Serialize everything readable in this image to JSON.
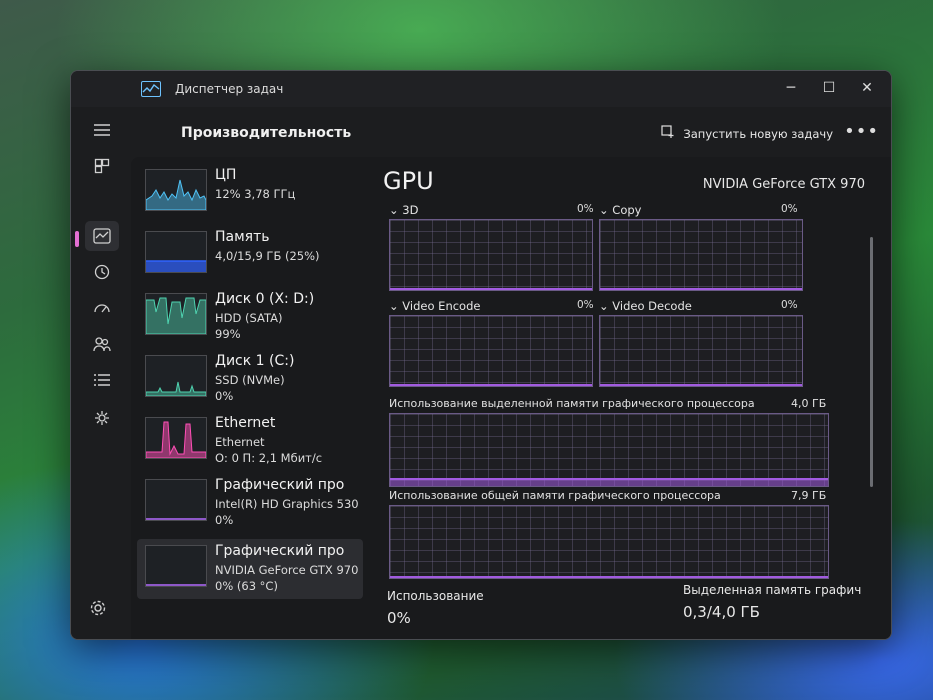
{
  "window": {
    "title": "Диспетчер задач"
  },
  "header": {
    "section_title": "Производительность",
    "run_task_label": "Запустить новую задачу",
    "more_label": "•••"
  },
  "controls": {
    "minimize": "─",
    "maximize": "☐",
    "close": "✕"
  },
  "nav": {
    "menu_icon": "hamburger-icon",
    "items": [
      "processes-icon",
      "performance-icon",
      "app-history-icon",
      "startup-apps-icon",
      "users-icon",
      "details-icon",
      "services-icon"
    ],
    "active_index": 1,
    "settings_icon": "gear-icon"
  },
  "devices": [
    {
      "name": "ЦП",
      "sub": "12% 3,78 ГГц",
      "value": "",
      "color": "#4fc3f7"
    },
    {
      "name": "Память",
      "sub": "4,0/15,9 ГБ (25%)",
      "value": "",
      "color": "#2f63ff"
    },
    {
      "name": "Диск 0 (X: D:)",
      "sub": "HDD (SATA)",
      "value": "99%",
      "color": "#4fd3b0"
    },
    {
      "name": "Диск 1 (C:)",
      "sub": "SSD (NVMe)",
      "value": "0%",
      "color": "#4fd3b0"
    },
    {
      "name": "Ethernet",
      "sub": "Ethernet",
      "value": "О: 0 П: 2,1 Мбит/с",
      "color": "#ff4fb6"
    },
    {
      "name": "Графический про",
      "sub": "Intel(R) HD Graphics 530",
      "value": "0%",
      "color": "#b36bff"
    },
    {
      "name": "Графический про",
      "sub": "NVIDIA GeForce GTX 970",
      "value": "0% (63 °C)",
      "color": "#b36bff"
    }
  ],
  "gpu": {
    "title": "GPU",
    "model": "NVIDIA GeForce GTX 970",
    "engines": [
      {
        "label": "3D",
        "pct": "0%"
      },
      {
        "label": "Copy",
        "pct": "0%"
      },
      {
        "label": "Video Encode",
        "pct": "0%"
      },
      {
        "label": "Video Decode",
        "pct": "0%"
      }
    ],
    "dedicated_memory": {
      "label": "Использование выделенной памяти графического процессора",
      "value": "4,0 ГБ"
    },
    "shared_memory": {
      "label": "Использование общей памяти графического процессора",
      "value": "7,9 ГБ"
    },
    "usage_label": "Использование",
    "usage_value": "0%",
    "dedicated_label": "Выделенная память графич",
    "dedicated_value": "0,3/4,0 ГБ",
    "accent": "#a25be0"
  }
}
